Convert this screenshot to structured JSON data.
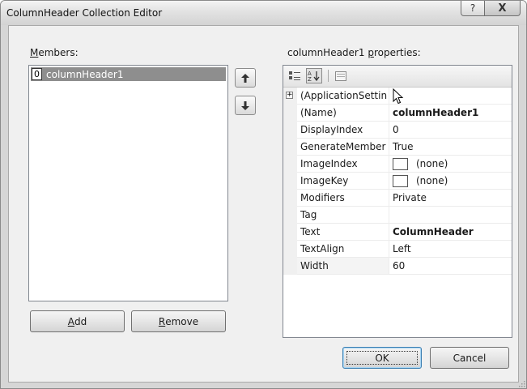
{
  "window": {
    "title": "ColumnHeader Collection Editor"
  },
  "caption_buttons": {
    "help": "?",
    "close": "X"
  },
  "members": {
    "label_prefix": "M",
    "label_rest": "embers:",
    "items": [
      {
        "index": "0",
        "name": "columnHeader1"
      }
    ]
  },
  "move_buttons": {
    "up": "🠕",
    "down": "🠗"
  },
  "buttons": {
    "add_prefix": "A",
    "add_rest": "dd",
    "remove_prefix": "R",
    "remove_rest": "emove",
    "ok": "OK",
    "cancel": "Cancel"
  },
  "properties": {
    "label_before": "columnHeader1 ",
    "label_mnemonic": "p",
    "label_after": "roperties:",
    "rows": [
      {
        "name": "(ApplicationSettin",
        "value": "",
        "expand": "+"
      },
      {
        "name": "(Name)",
        "value": "columnHeader1"
      },
      {
        "name": "DisplayIndex",
        "value": "0"
      },
      {
        "name": "GenerateMember",
        "value": "True"
      },
      {
        "name": "ImageIndex",
        "value": "(none)"
      },
      {
        "name": "ImageKey",
        "value": "(none)"
      },
      {
        "name": "Modifiers",
        "value": "Private"
      },
      {
        "name": "Tag",
        "value": ""
      },
      {
        "name": "Text",
        "value": "ColumnHeader"
      },
      {
        "name": "TextAlign",
        "value": "Left"
      },
      {
        "name": "Width",
        "value": "60"
      }
    ]
  },
  "icons": {
    "categorized": "categorized-icon",
    "alphabetical": "alphabetical-sort-icon",
    "property_pages": "property-pages-icon",
    "cursor": "mouse-pointer-icon",
    "resize": "resize-grip-icon"
  },
  "colors": {
    "selection": "#8e8e8e",
    "dialog_bg": "#f0f0f0",
    "default_button_border": "#3c7fb1"
  }
}
